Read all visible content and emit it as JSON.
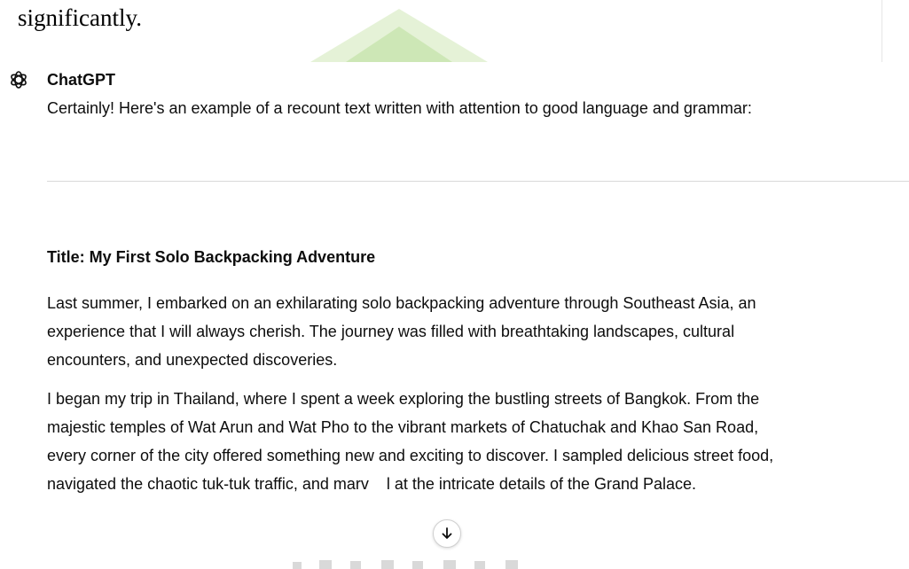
{
  "document": {
    "top_text": "significantly."
  },
  "message": {
    "author": "ChatGPT",
    "intro": "Certainly! Here's an example of a recount text written with attention to good language and grammar:",
    "title": "Title: My First Solo Backpacking Adventure",
    "paragraph_1_lines": [
      "Last summer, I embarked on an exhilarating solo backpacking adventure through Southeast Asia, an",
      "experience that I will always cherish. The journey was filled with breathtaking landscapes, cultural",
      "encounters, and unexpected discoveries."
    ],
    "paragraph_2_lines": [
      "I began my trip in Thailand, where I spent a week exploring the bustling streets of Bangkok. From the",
      "majestic temples of Wat Arun and Wat Pho to the vibrant markets of Chatuchak and Khao San Road,",
      "every corner of the city offered something new and exciting to discover. I sampled delicious street food,"
    ],
    "paragraph_2_last_before": "navigated the chaotic tuk-tuk traffic, and marv",
    "paragraph_2_last_after": "l at the intricate details of the Grand Palace."
  },
  "icons": {
    "avatar": "openai-logo-icon",
    "scroll_down": "arrow-down-icon"
  },
  "colors": {
    "text": "#0d0d0d",
    "divider": "#d9d9d9",
    "watermark": "#c8e6b0"
  }
}
